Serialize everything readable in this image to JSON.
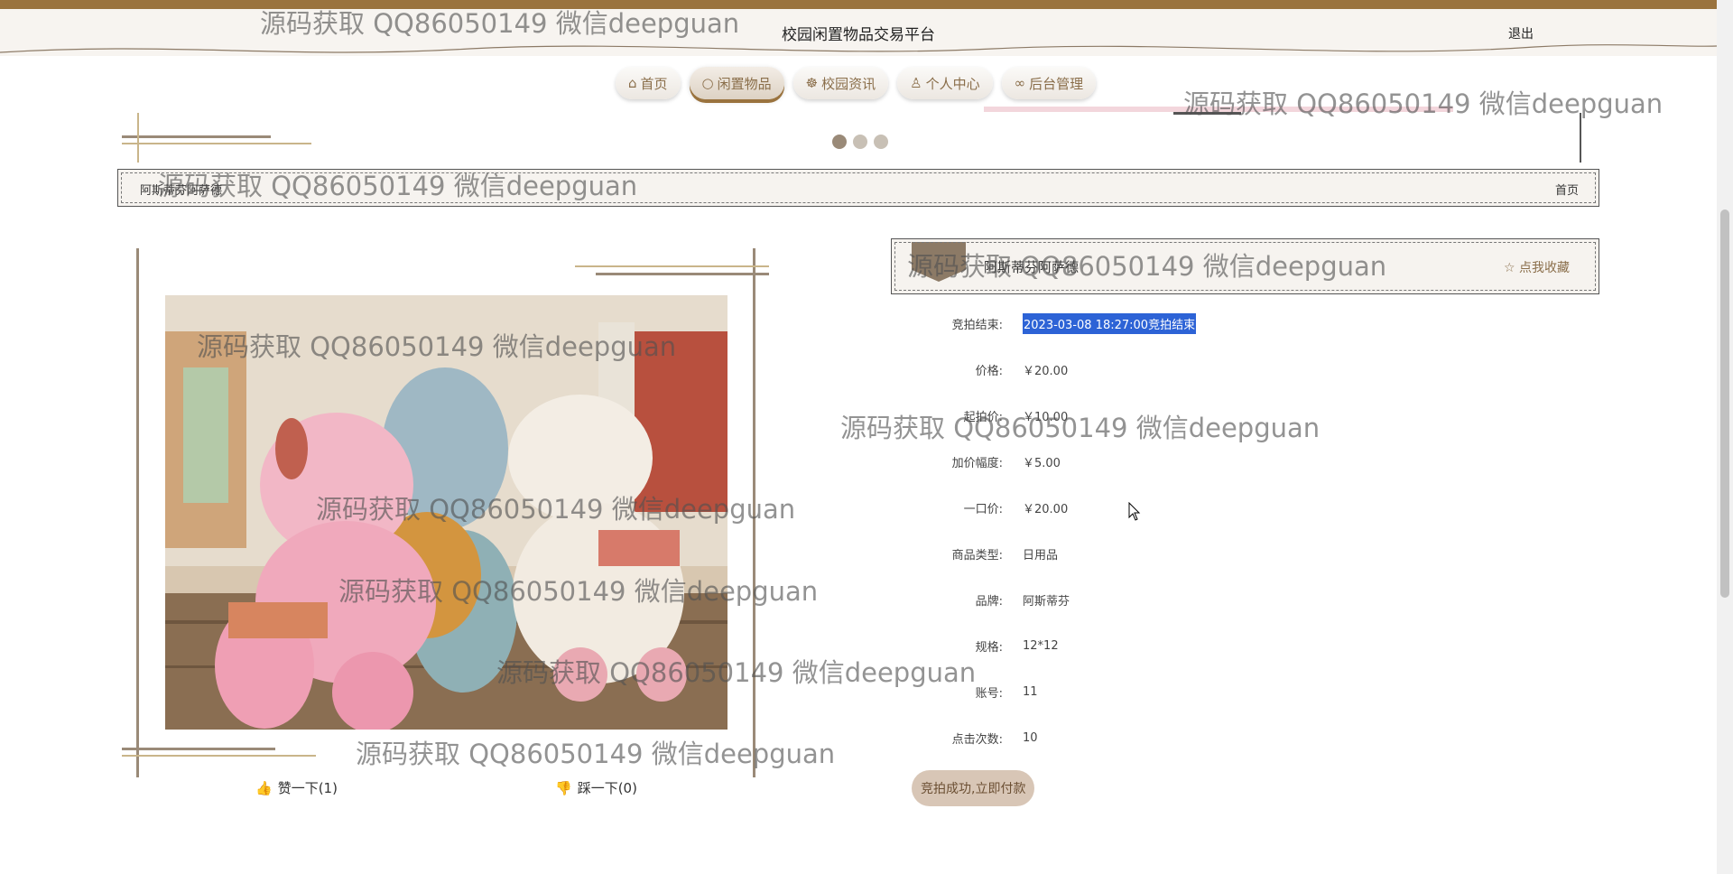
{
  "header": {
    "site_title": "校园闲置物品交易平台",
    "logout_label": "退出",
    "brand_color": "#9a733e"
  },
  "nav": {
    "items": [
      {
        "icon": "home-icon",
        "label": "首页"
      },
      {
        "icon": "circle-icon",
        "label": "闲置物品",
        "active": true
      },
      {
        "icon": "palette-icon",
        "label": "校园资讯"
      },
      {
        "icon": "user-icon",
        "label": "个人中心"
      },
      {
        "icon": "link-icon",
        "label": "后台管理"
      }
    ]
  },
  "carousel": {
    "dot_count": 3,
    "active_index": 0
  },
  "breadcrumb": {
    "current": "阿斯蒂芬阿萨德",
    "home": "首页"
  },
  "product": {
    "title": "阿斯蒂芬阿萨德",
    "favorite_label": "☆ 点我收藏",
    "image_alt": "llama plush toys",
    "details": [
      {
        "label": "竞拍结束:",
        "value": "2023-03-08 18:27:00竞拍结束",
        "highlight": true
      },
      {
        "label": "价格:",
        "value": "￥20.00"
      },
      {
        "label": "起拍价:",
        "value": "￥10.00"
      },
      {
        "label": "加价幅度:",
        "value": "￥5.00"
      },
      {
        "label": "一口价:",
        "value": "￥20.00"
      },
      {
        "label": "商品类型:",
        "value": "日用品"
      },
      {
        "label": "品牌:",
        "value": "阿斯蒂芬"
      },
      {
        "label": "规格:",
        "value": "12*12"
      },
      {
        "label": "账号:",
        "value": "11"
      },
      {
        "label": "点击次数:",
        "value": "10"
      }
    ],
    "pay_label": "竞拍成功,立即付款",
    "like_label": "赞一下(1)",
    "dislike_label": "踩一下(0)"
  },
  "watermark": {
    "text": "源码获取 QQ86050149 微信deepguan"
  }
}
